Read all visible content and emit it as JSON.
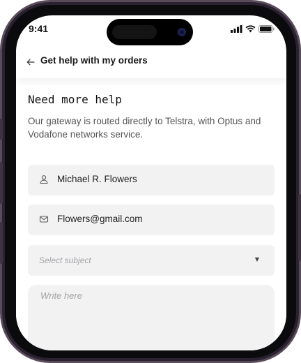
{
  "status_bar": {
    "time": "9:41",
    "icons": [
      "signal-icon",
      "wifi-icon",
      "battery-icon"
    ]
  },
  "header": {
    "back_icon": "arrow-left-icon",
    "title": "Get help with my orders"
  },
  "main": {
    "title": "Need more help",
    "description": "Our gateway is routed directly to Telstra, with Optus and Vodafone networks service.",
    "name_field": {
      "icon": "user-icon",
      "value": "Michael R. Flowers"
    },
    "email_field": {
      "icon": "mail-icon",
      "value": "Flowers@gmail.com"
    },
    "subject_select": {
      "placeholder": "Select subject",
      "icon": "dropdown-caret-icon"
    },
    "message_field": {
      "placeholder": "Write here"
    }
  },
  "colors": {
    "frame": "#2a2230",
    "field_bg": "#f2f2f3",
    "text": "#1a1a1a",
    "muted": "#555555",
    "placeholder": "#a3a3a7"
  }
}
